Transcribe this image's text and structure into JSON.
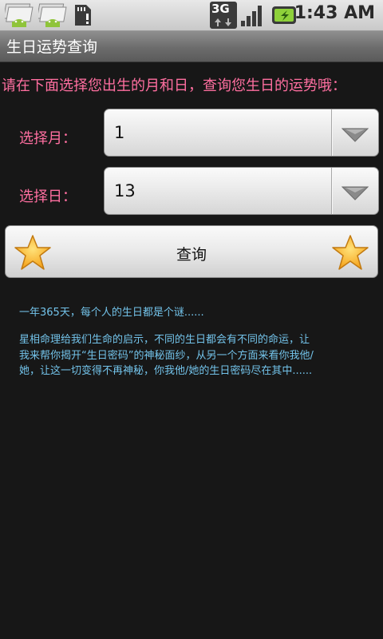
{
  "status_bar": {
    "network": "3G",
    "time": "1:43 AM"
  },
  "app": {
    "title": "生日运势查询"
  },
  "form": {
    "prompt": "请在下面选择您出生的月和日，查询您生日的运势哦：",
    "month_label": "选择月：",
    "month_value": "1",
    "day_label": "选择日：",
    "day_value": "13",
    "query_button": "查询"
  },
  "info": {
    "para1": "一年365天，每个人的生日都是个谜......",
    "para2_line1": "星相命理给我们生命的启示，不同的生日都会有不同的命运，让",
    "para2_line2": "我来帮你揭开“生日密码”的神秘面纱，从另一个方面来看你我他/",
    "para2_line3": "她，让这一切变得不再神秘，你我他/她的生日密码尽在其中......"
  },
  "colors": {
    "accent_pink": "#ff6fa0",
    "info_blue": "#73c3ea",
    "background": "#171717"
  }
}
